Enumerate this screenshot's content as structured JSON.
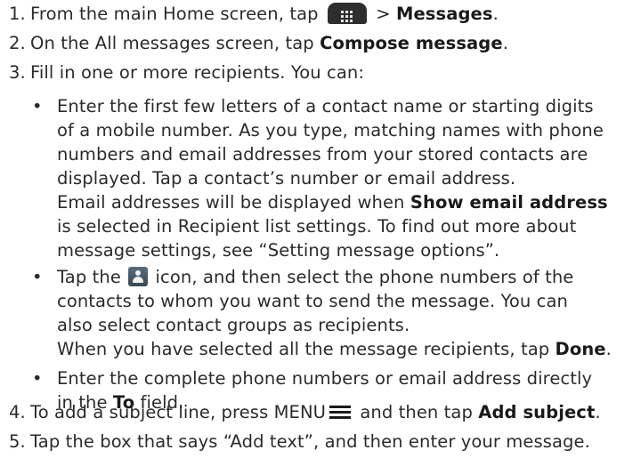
{
  "steps": [
    {
      "number": "1.",
      "pre": "From the main Home screen, tap",
      "post": " > ",
      "ui": "Messages",
      "end": "."
    },
    {
      "number": "2.",
      "pre": "On the All messages screen, tap ",
      "ui": "Compose message",
      "end": "."
    },
    {
      "number": "3.",
      "text": "Fill in one or more recipients. You can:"
    },
    {
      "number": "4.",
      "pre": "To add a subject line, press MENU",
      "post": " and then tap ",
      "ui": "Add subject",
      "end": "."
    },
    {
      "number": "5.",
      "text": "Tap the box that says “Add text”, and then enter your message."
    }
  ],
  "bullets": [
    {
      "lines": [
        "Enter the first few letters of a contact name or starting digits",
        "of a mobile number. As you type, matching names with phone",
        "numbers and email addresses from your stored contacts are",
        "displayed. Tap a contact’s number or email address."
      ],
      "email_pre": "Email addresses will be displayed when ",
      "email_ui": "Show email address",
      "email_lines": [
        "is selected in Recipient list settings. To find out more about",
        "message settings, see “Setting message options”."
      ]
    },
    {
      "l1_pre": "Tap the ",
      "l1_post": " icon, and then select the phone numbers of the",
      "lines": [
        "contacts to whom you want to send the message. You can",
        "also select contact groups as recipients."
      ],
      "done_pre": "When you have selected all the message recipients, tap ",
      "done_ui": "Done",
      "done_end": "."
    },
    {
      "lines": [
        "Enter the complete phone numbers or email address directly"
      ],
      "to_pre": "in the ",
      "to_ui": "To",
      "to_post": " field."
    }
  ],
  "bullet_symbol": "•",
  "icons": {
    "step1": "all-apps-icon",
    "bullet2": "contact-picker-icon",
    "step4": "menu-icon"
  }
}
